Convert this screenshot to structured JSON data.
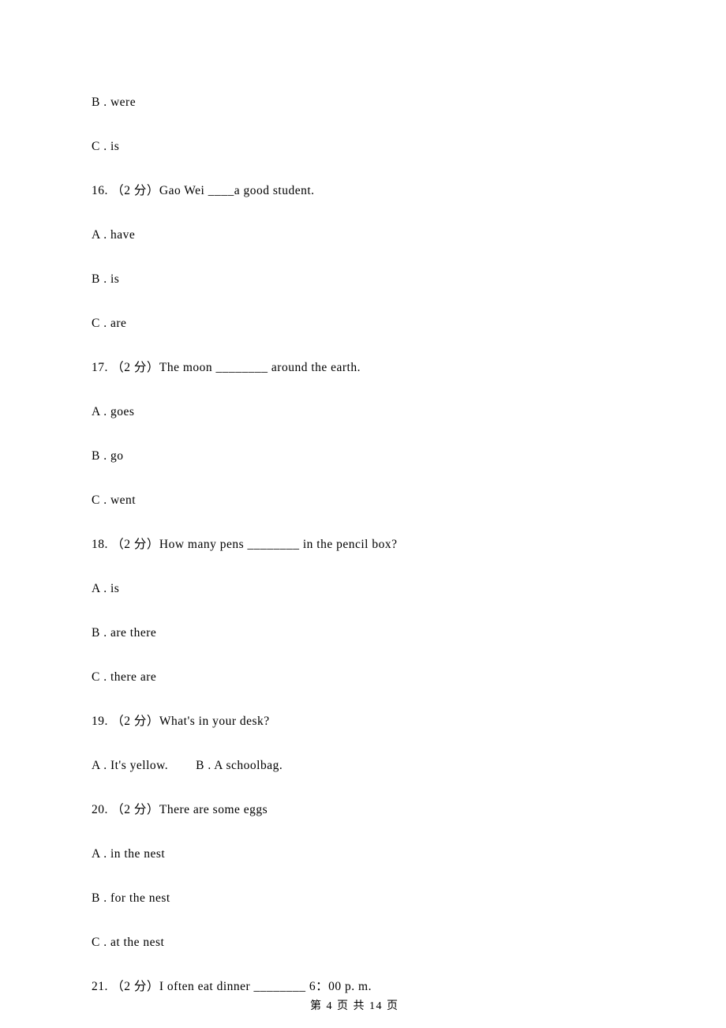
{
  "lines": {
    "l1": "B . were",
    "l2": "C . is",
    "l3": "16. （2 分）Gao Wei ____a good student.",
    "l4": "A . have",
    "l5": "B . is",
    "l6": "C . are",
    "l7": "17. （2 分）The moon ________ around the earth.",
    "l8": "A . goes",
    "l9": "B . go",
    "l10": "C . went",
    "l11": "18. （2 分）How many pens ________ in the pencil box?",
    "l12": "A . is",
    "l13": "B . are there",
    "l14": "C . there are",
    "l15": "19. （2 分）What's in your desk?",
    "l16": "A . It's yellow.        B . A schoolbag.",
    "l17": "20. （2 分）There are some eggs",
    "l18": "A . in the nest",
    "l19": "B . for the nest",
    "l20": "C . at the nest",
    "l21": "21. （2 分）I often eat dinner ________ 6：00 p. m."
  },
  "footer": "第 4 页 共 14 页"
}
